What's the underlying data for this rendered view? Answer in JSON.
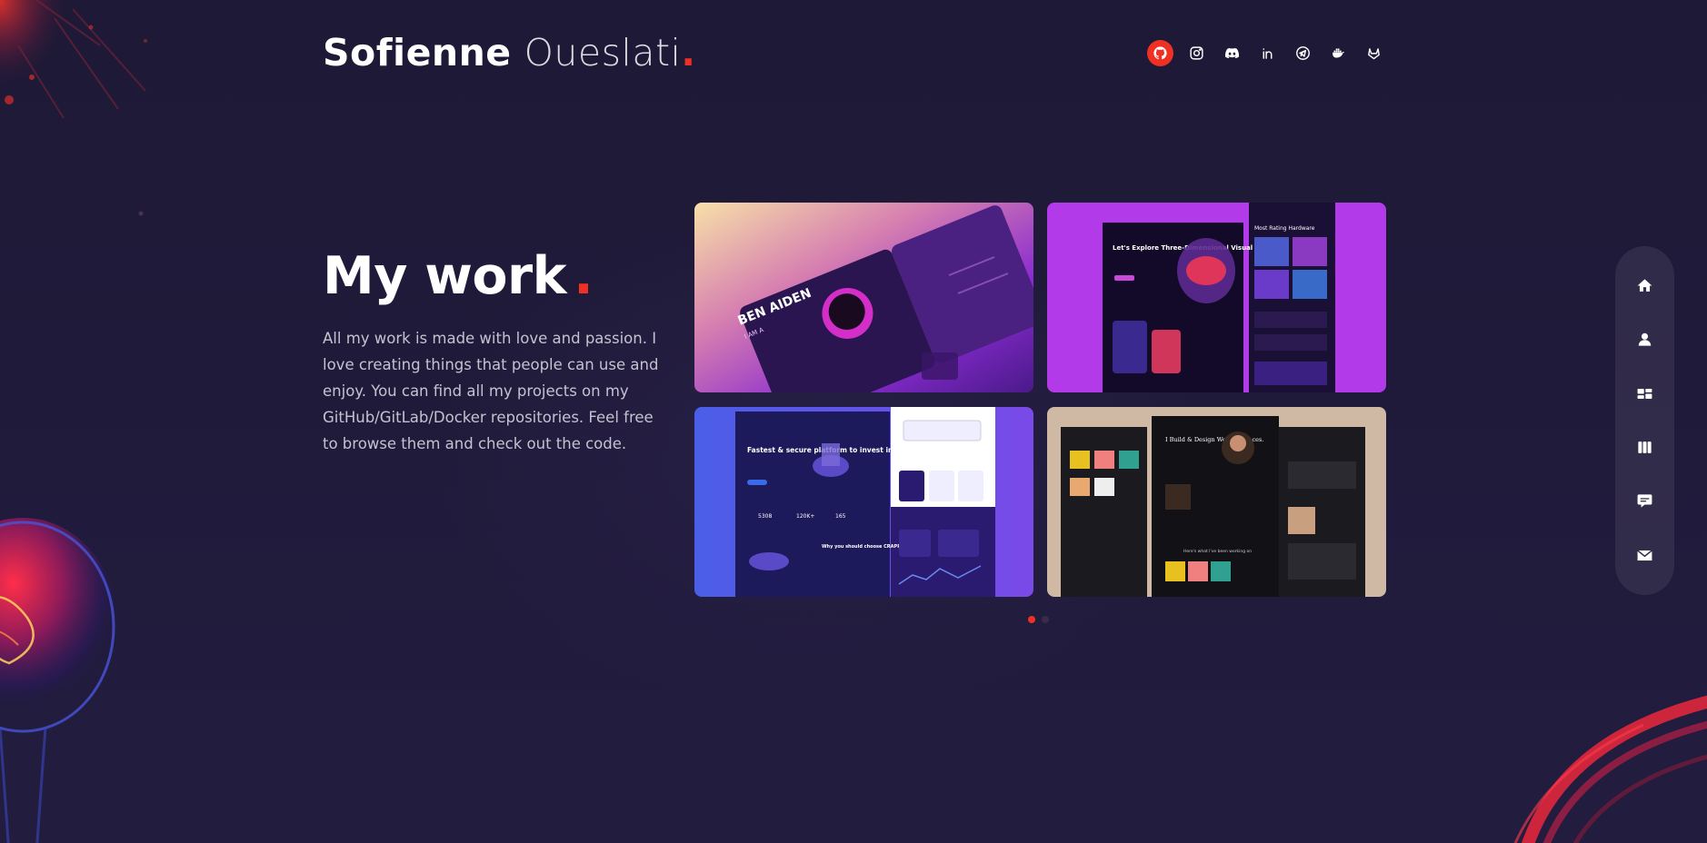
{
  "header": {
    "logo_first": "Sofienne",
    "logo_last": "Oueslati",
    "logo_dot": ".",
    "socials": [
      {
        "name": "github-icon",
        "active": true
      },
      {
        "name": "instagram-icon",
        "active": false
      },
      {
        "name": "discord-icon",
        "active": false
      },
      {
        "name": "linkedin-icon",
        "active": false
      },
      {
        "name": "telegram-icon",
        "active": false
      },
      {
        "name": "docker-icon",
        "active": false
      },
      {
        "name": "gitlab-icon",
        "active": false
      }
    ]
  },
  "intro": {
    "title": "My work",
    "title_dot": ".",
    "description": "All my work is made with love and passion. I love creating things that people can use and enjoy. You can find all my projects on my GitHub/GitLab/Docker repositories. Feel free to browse them and check out the code."
  },
  "projects": [
    {
      "heading": "BEN AIDEN",
      "sub": "I AM A"
    },
    {
      "heading": "Let's Explore Three-Dimensional Visual",
      "sub": "Most Rating Hardware"
    },
    {
      "heading": "Fastest & secure platform to invest in crypto",
      "sub": "Why you should choose CRAPPO",
      "stats": [
        "5308",
        "120K+",
        "165"
      ]
    },
    {
      "heading": "I Build & Design Web Interfaces.",
      "sub": "Here's what I've been working on"
    }
  ],
  "pagination": {
    "count": 2,
    "active": 0
  },
  "sidenav": [
    {
      "name": "home-icon"
    },
    {
      "name": "about-icon"
    },
    {
      "name": "services-icon"
    },
    {
      "name": "work-icon"
    },
    {
      "name": "testimonials-icon"
    },
    {
      "name": "contact-icon"
    }
  ],
  "colors": {
    "accent": "#f13024",
    "background": "#1f1a38"
  }
}
